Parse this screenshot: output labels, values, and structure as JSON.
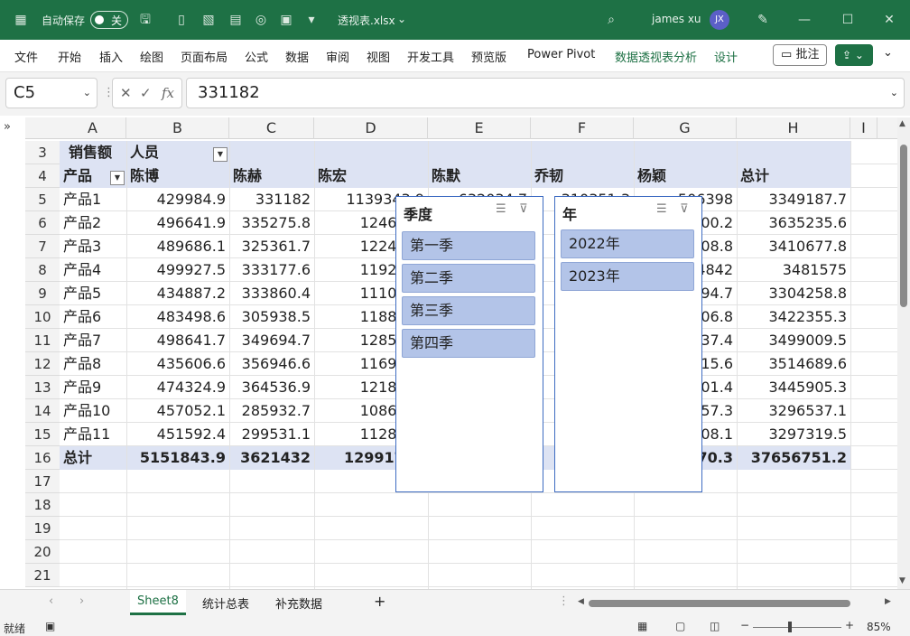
{
  "titlebar": {
    "autosave_label": "自动保存",
    "autosave_state": "关",
    "filename": "透视表.xlsx",
    "user_name": "james xu",
    "user_initials": "JX"
  },
  "ribbon": {
    "tabs": [
      "文件",
      "开始",
      "插入",
      "绘图",
      "页面布局",
      "公式",
      "数据",
      "审阅",
      "视图",
      "开发工具",
      "预览版",
      "Power Pivot",
      "数据透视表分析",
      "设计"
    ],
    "comment_label": "批注"
  },
  "formula_bar": {
    "name_box": "C5",
    "fx_label": "fx",
    "formula": "331182"
  },
  "columns": [
    "A",
    "B",
    "C",
    "D",
    "E",
    "F",
    "G",
    "H",
    "I"
  ],
  "pivot": {
    "header_row3": {
      "row": "3",
      "label_a": "销售额",
      "label_b": "人员"
    },
    "header_row4": {
      "row": "4",
      "cells": [
        "产品",
        "陈博",
        "陈赫",
        "陈宏",
        "陈默",
        "乔韧",
        "杨颖",
        "总计"
      ]
    },
    "data_rows": [
      {
        "row": "5",
        "cells": [
          "产品1",
          "429984.9",
          "331182",
          "1139343.9",
          "632034.7",
          "310351.3",
          "506398",
          "3349187.7"
        ]
      },
      {
        "row": "6",
        "cells": [
          "产品2",
          "496641.9",
          "335275.8",
          "1246854",
          "",
          "",
          "400.2",
          "3635235.6"
        ]
      },
      {
        "row": "7",
        "cells": [
          "产品3",
          "489686.1",
          "325361.7",
          "1224413",
          "",
          "",
          "708.8",
          "3410677.8"
        ]
      },
      {
        "row": "8",
        "cells": [
          "产品4",
          "499927.5",
          "333177.6",
          "1192483",
          "",
          "",
          "4842",
          "3481575"
        ]
      },
      {
        "row": "9",
        "cells": [
          "产品5",
          "434887.2",
          "333860.4",
          "1110913",
          "",
          "",
          "794.7",
          "3304258.8"
        ]
      },
      {
        "row": "10",
        "cells": [
          "产品6",
          "483498.6",
          "305938.5",
          "1188201",
          "",
          "",
          "306.8",
          "3422355.3"
        ]
      },
      {
        "row": "11",
        "cells": [
          "产品7",
          "498641.7",
          "349694.7",
          "1285744",
          "",
          "",
          "337.4",
          "3499009.5"
        ]
      },
      {
        "row": "12",
        "cells": [
          "产品8",
          "435606.6",
          "356946.6",
          "1169777",
          "",
          "",
          "115.6",
          "3514689.6"
        ]
      },
      {
        "row": "13",
        "cells": [
          "产品9",
          "474324.9",
          "364536.9",
          "1218837",
          "",
          "",
          "301.4",
          "3445905.3"
        ]
      },
      {
        "row": "14",
        "cells": [
          "产品10",
          "457052.1",
          "285932.7",
          "1086996",
          "",
          "",
          "757.3",
          "3296537.1"
        ]
      },
      {
        "row": "15",
        "cells": [
          "产品11",
          "451592.4",
          "299531.1",
          "1128169",
          "",
          "",
          "308.1",
          "3297319.5"
        ]
      }
    ],
    "total_row": {
      "row": "16",
      "cells": [
        "总计",
        "5151843.9",
        "3621432",
        "12991741",
        "",
        "2",
        "170.3",
        "37656751.2"
      ]
    },
    "empty_rows": [
      "17",
      "18",
      "19",
      "20",
      "21"
    ]
  },
  "slicers": {
    "quarter": {
      "title": "季度",
      "items": [
        "第一季",
        "第二季",
        "第三季",
        "第四季"
      ]
    },
    "year": {
      "title": "年",
      "items": [
        "2022年",
        "2023年"
      ]
    }
  },
  "sheet_tabs": [
    "Sheet8",
    "统计总表",
    "补充数据"
  ],
  "status": {
    "ready": "就绪",
    "zoom": "85%"
  }
}
